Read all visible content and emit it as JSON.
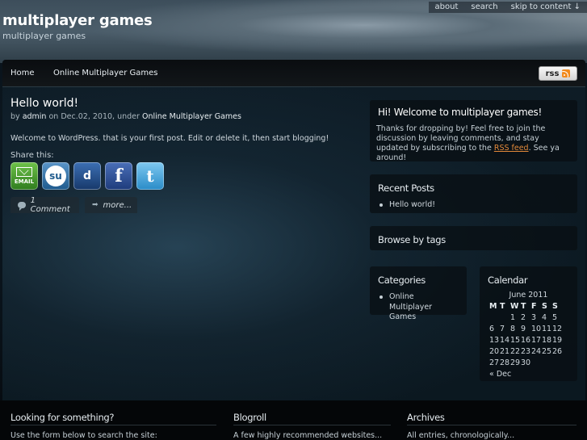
{
  "header": {
    "site_title": "multiplayer games",
    "tagline": "multiplayer games",
    "top_links": [
      "about",
      "search",
      "skip to content ↓"
    ]
  },
  "navbar": {
    "items": [
      "Home",
      "Online Multiplayer Games"
    ],
    "rss_label": "rss"
  },
  "post": {
    "title": "Hello world!",
    "meta_by": "by",
    "meta_author": "admin",
    "meta_on": "on Dec.02, 2010, under",
    "meta_category": "Online Multiplayer Games",
    "body": "Welcome to WordPress. that is your first post. Edit or delete it, then start blogging!",
    "share_label": "Share this:",
    "share_icons": {
      "email": "EMAIL",
      "stumbleupon": "su",
      "delicious": "d",
      "facebook": "f",
      "twitter": "t"
    },
    "comment_label": "1 Comment",
    "more_label": "more..."
  },
  "sidebar": {
    "welcome_title": "Hi! Welcome to multiplayer games!",
    "welcome_text_1": "Thanks for dropping by! Feel free to join the discussion by leaving comments, and stay updated by subscribing to the",
    "welcome_link": "RSS feed",
    "welcome_text_2": ". See ya around!",
    "recent_title": "Recent Posts",
    "recent_items": [
      "Hello world!"
    ],
    "tags_title": "Browse by tags",
    "categories_title": "Categories",
    "category_items": [
      "Online Multiplayer Games"
    ],
    "calendar_title": "Calendar",
    "calendar_caption": "June 2011",
    "calendar_headers": [
      "M",
      "T",
      "W",
      "T",
      "F",
      "S",
      "S"
    ],
    "calendar_cells": [
      "",
      "",
      "1",
      "2",
      "3",
      "4",
      "5",
      "6",
      "7",
      "8",
      "9",
      "10",
      "11",
      "12",
      "13",
      "14",
      "15",
      "16",
      "17",
      "18",
      "19",
      "20",
      "21",
      "22",
      "23",
      "24",
      "25",
      "26",
      "27",
      "28",
      "29",
      "30",
      "",
      "",
      ""
    ],
    "calendar_prev": "« Dec"
  },
  "footer": {
    "col1_title": "Looking for something?",
    "col1_text": "Use the form below to search the site:",
    "col2_title": "Blogroll",
    "col2_text": "A few highly recommended websites...",
    "col3_title": "Archives",
    "col3_text": "All entries, chronologically..."
  },
  "colors": {
    "link_accent": "#e2893a",
    "rss_orange": "#f28a1d"
  }
}
